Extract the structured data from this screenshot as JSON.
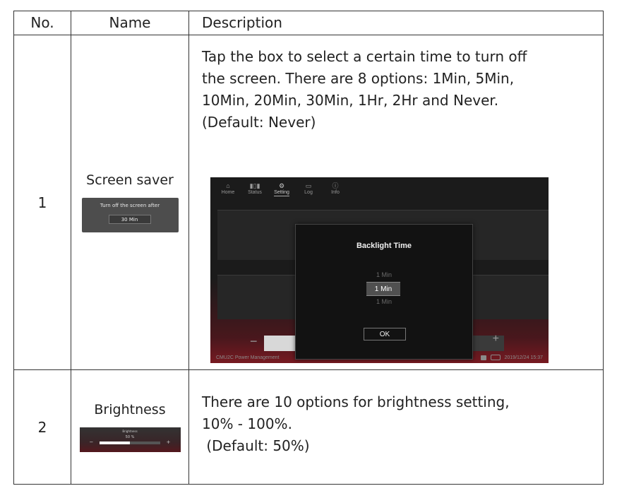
{
  "header": {
    "no": "No.",
    "name": "Name",
    "description": "Description"
  },
  "rows": [
    {
      "no": "1",
      "name": "Screen saver",
      "thumb": {
        "title": "Turn off the screen after",
        "value": "30 Min"
      },
      "description": [
        "Tap the box to select a certain time to turn off",
        "the screen. There are 8 options: 1Min, 5Min,",
        "10Min, 20Min, 30Min, 1Hr, 2Hr and Never.",
        "(Default: Never)"
      ],
      "screenshot": {
        "nav": [
          "Home",
          "Status",
          "Setting",
          "Log",
          "Info"
        ],
        "nav_active": "Setting",
        "dialog_title": "Backlight Time",
        "picker_prev": "1 Min",
        "picker_selected": "1 Min",
        "picker_next": "1 Min",
        "ok": "OK",
        "minus": "−",
        "plus": "+",
        "footer_left": "CMU2C Power Management",
        "footer_right": "2019/12/24 15:37"
      }
    },
    {
      "no": "2",
      "name": "Brightness",
      "thumb": {
        "title": "Brightness",
        "value": "50 %",
        "minus": "−",
        "plus": "+",
        "level": 0.5
      },
      "description": [
        "There are 10 options for brightness setting,",
        "10% - 100%.",
        " (Default: 50%)"
      ]
    }
  ],
  "colors": {
    "border": "#333333",
    "screen_bg": "#1b1b1b",
    "accent_red": "#96191f"
  }
}
